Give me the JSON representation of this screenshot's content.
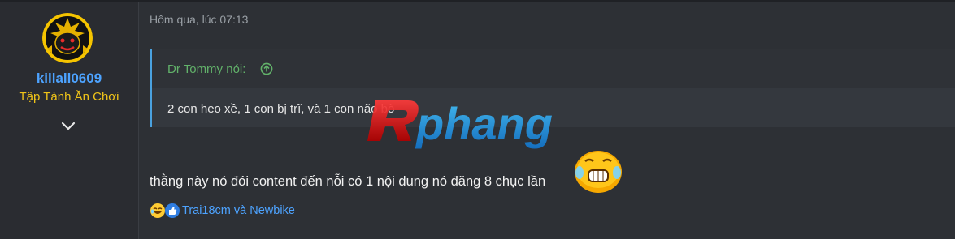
{
  "user": {
    "name": "killall0609",
    "title": "Tập Tành Ăn Chơi",
    "avatar": "panther-emblem-avatar",
    "expand_icon": "chevron-down-icon"
  },
  "post": {
    "timestamp": "Hôm qua, lúc 07:13",
    "quote": {
      "author_label": "Dr Tommy nói:",
      "arrow_icon": "arrow-up-circle-icon",
      "text": "2 con heo xề, 1 con bị trĩ, và 1 con não bò"
    },
    "message": "thằng này nó đói content đến nỗi có 1 nội dung nó đăng 8 chục lần",
    "emoji": "grinning-sweat-emoji",
    "reactions": {
      "icons": [
        "laugh-reaction-icon",
        "like-reaction-icon"
      ],
      "text": "Trai18cm và Newbike"
    }
  },
  "watermark": {
    "brand": "Rphang"
  },
  "colors": {
    "background": "#2d3035",
    "username": "#4da3ff",
    "usertitle": "#f0c419",
    "quote_author": "#62b26a",
    "quote_border": "#4aa2e0"
  }
}
